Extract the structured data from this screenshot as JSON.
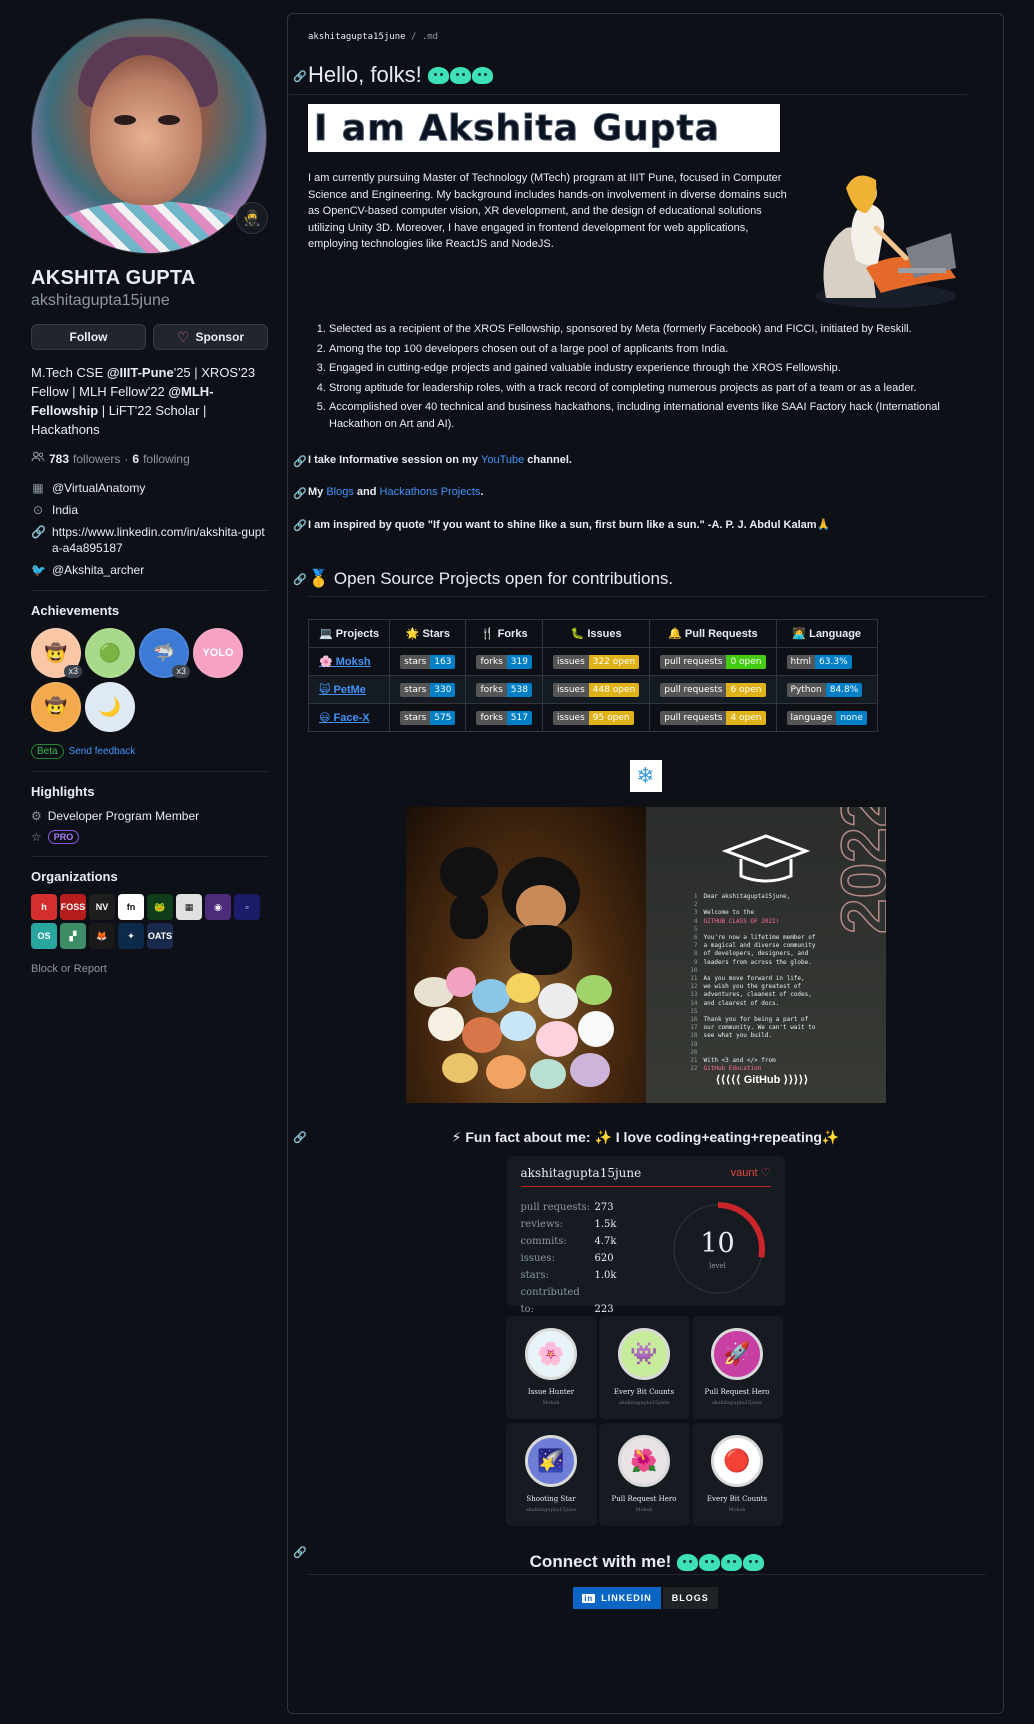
{
  "profile": {
    "status_emoji": "🥷",
    "fullname": "AKSHITA GUPTA",
    "username": "akshitagupta15june",
    "follow_label": "Follow",
    "sponsor_label": "Sponsor",
    "bio_part1": "M.Tech CSE ",
    "bio_org1": "@IIIT-Pune",
    "bio_part2": "'25 | XROS'23 Fellow | MLH Fellow'22 ",
    "bio_org2": "@MLH-Fellowship",
    "bio_part3": " | LiFT'22 Scholar | Hackathons",
    "followers_count": "783",
    "followers_label": "followers",
    "following_count": "6",
    "following_label": "following",
    "company": "@VirtualAnatomy",
    "location": "India",
    "website": "https://www.linkedin.com/in/akshita-gupta-a4a895187",
    "twitter": "@Akshita_archer"
  },
  "achievements": {
    "title": "Achievements",
    "items": [
      {
        "icon": "🤠",
        "count": "x3",
        "color": "#f9c6a6"
      },
      {
        "icon": "🟢",
        "count": "",
        "color": "#a8d98a"
      },
      {
        "icon": "🦈",
        "count": "x3",
        "color": "#3b7bd6"
      },
      {
        "icon": "YOLO",
        "count": "",
        "color": "#f7a1c4"
      },
      {
        "icon": "🤠",
        "count": "",
        "color": "#f4a94d"
      },
      {
        "icon": "🌙",
        "count": "",
        "color": "#dfe8f5"
      }
    ],
    "beta": "Beta",
    "feedback": "Send feedback"
  },
  "highlights": {
    "title": "Highlights",
    "program": "Developer Program Member",
    "pro": "PRO"
  },
  "organizations": {
    "title": "Organizations",
    "items": [
      {
        "text": "h",
        "color": "#d32f2f"
      },
      {
        "text": "FOSS",
        "color": "#b71c1c"
      },
      {
        "text": "NV",
        "color": "#1e1e1e"
      },
      {
        "text": "fn",
        "color": "#ffffff"
      },
      {
        "text": "🐸",
        "color": "#0f3d1a"
      },
      {
        "text": "▦",
        "color": "#e0e0e0"
      },
      {
        "text": "◉",
        "color": "#4b2b7a"
      },
      {
        "text": "▫",
        "color": "#1b1d6b"
      },
      {
        "text": "OS",
        "color": "#2aa6a0"
      },
      {
        "text": "▞",
        "color": "#3e8d66"
      },
      {
        "text": "🦊",
        "color": "#1a1a1a"
      },
      {
        "text": "✦",
        "color": "#0e2a4a"
      },
      {
        "text": "OATS",
        "color": "#1a2a4a"
      }
    ],
    "block_report": "Block or Report"
  },
  "readme": {
    "file_owner": "akshitagupta15june",
    "file_name": ".md",
    "heading": "Hello, folks!",
    "banner": "I am Akshita Gupta",
    "intro": "I am currently pursuing Master of Technology (MTech) program at IIIT Pune, focused in Computer Science and Engineering. My background includes hands-on involvement in diverse domains such as OpenCV-based computer vision, XR development, and the design of educational solutions utilizing Unity 3D. Moreover, I have engaged in frontend development for web applications, employing technologies like ReactJS and NodeJS.",
    "list": [
      "Selected as a recipient of the XROS Fellowship, sponsored by Meta (formerly Facebook) and FICCI, initiated by Reskill.",
      "Among the top 100 developers chosen out of a large pool of applicants from India.",
      "Engaged in cutting-edge projects and gained valuable industry experience through the XROS Fellowship.",
      "Strong aptitude for leadership roles, with a track record of completing numerous projects as part of a team or as a leader.",
      "Accomplished over 40 technical and business hackathons, including international events like SAAI Factory hack (International Hackathon on Art and AI)."
    ],
    "session_pre": "I take Informative session on my ",
    "session_link": "YouTube",
    "session_post": " channel.",
    "my": "My ",
    "blogs": "Blogs",
    "and": " and ",
    "hack_projects": "Hackathons Projects",
    "dot": ".",
    "quote": "I am inspired by quote \"If you want to shine like a sun, first burn like a sun.\" -A. P. J. Abdul Kalam🙏",
    "os_heading": "🥇 Open Source Projects open for contributions.",
    "fun_fact": "⚡ Fun fact about me: ✨ I love coding+eating+repeating✨",
    "connect": "Connect with me!"
  },
  "projects": {
    "headers": [
      "💻 Projects",
      "🌟 Stars",
      "🍴 Forks",
      "🐛 Issues",
      "🔔 Pull Requests",
      "👩‍💻 Language"
    ],
    "rows": [
      {
        "name": "🌸 Moksh",
        "stars": "163",
        "forks": "319",
        "issues": "322 open",
        "prs": "0 open",
        "pr_color": "#4c1",
        "lang_label": "html",
        "lang_value": "63.3%"
      },
      {
        "name": "🙀 PetMe",
        "stars": "330",
        "forks": "538",
        "issues": "448 open",
        "prs": "6 open",
        "pr_color": "#dfb317",
        "lang_label": "Python",
        "lang_value": "84.8%"
      },
      {
        "name": "😃 Face-X",
        "stars": "575",
        "forks": "517",
        "issues": "95 open",
        "prs": "4 open",
        "pr_color": "#dfb317",
        "lang_label": "language",
        "lang_value": "none"
      }
    ],
    "stars_label": "stars",
    "forks_label": "forks",
    "issues_label": "issues",
    "prs_label": "pull requests"
  },
  "photo": {
    "cert_lines": [
      "Dear akshitagupta15june,",
      "",
      "Welcome to the",
      "GITHUB CLASS OF 2022!",
      "",
      "You're now a lifetime member of",
      "a magical and diverse community",
      "of developers, designers, and",
      "leaders from across the globe.",
      "",
      "As you move forward in life,",
      "we wish you the greatest of",
      "adventures, cleanest of codes,",
      "and clearest of docs.",
      "",
      "Thank you for being a part of",
      "our community. We can't wait to",
      "see what you build.",
      "",
      "",
      "With <3 and </> from",
      "GitHub Education"
    ],
    "year": "2022",
    "logo": "GitHub"
  },
  "vaunt": {
    "username": "akshitagupta15june",
    "brand": "vaunt",
    "stats": [
      {
        "k": "pull requests:",
        "v": "273"
      },
      {
        "k": "reviews:",
        "v": "1.5k"
      },
      {
        "k": "commits:",
        "v": "4.7k"
      },
      {
        "k": "issues:",
        "v": "620"
      },
      {
        "k": "stars:",
        "v": "1.0k"
      },
      {
        "k": "contributed to:",
        "v": "223"
      }
    ],
    "level": "10",
    "level_label": "level",
    "level_progress": 0.28,
    "achievements": [
      {
        "name": "Issue Hunter",
        "by": "Moksh",
        "icon": "🌸",
        "bg": "#e7f3f7"
      },
      {
        "name": "Every Bit Counts",
        "by": "akshitagupta15june",
        "icon": "👾",
        "bg": "#c6eb9a"
      },
      {
        "name": "Pull Request Hero",
        "by": "akshitagupta15june",
        "icon": "🚀",
        "bg": "#c83fa4"
      },
      {
        "name": "Shooting Star",
        "by": "akshitagupta15june",
        "icon": "🌠",
        "bg": "#6e7dd6"
      },
      {
        "name": "Pull Request Hero",
        "by": "Moksh",
        "icon": "🌺",
        "bg": "#e9e2e6"
      },
      {
        "name": "Every Bit Counts",
        "by": "Moksh",
        "icon": "🔴",
        "bg": "#ffffff"
      }
    ]
  },
  "social": {
    "linkedin": "LINKEDIN",
    "blogs": "BLOGS"
  }
}
